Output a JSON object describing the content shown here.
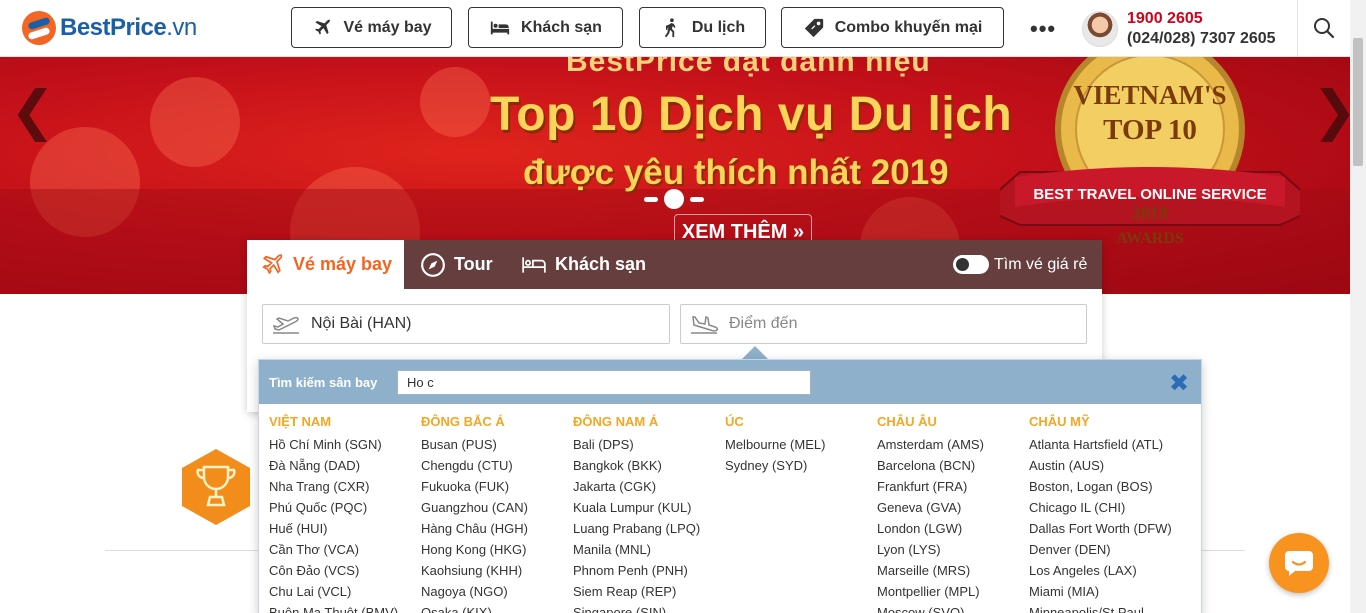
{
  "header": {
    "logo_brand": "BestPrice",
    "logo_tld": ".vn",
    "nav": [
      {
        "label": "Vé máy bay",
        "icon": "plane-icon"
      },
      {
        "label": "Khách sạn",
        "icon": "bed-icon"
      },
      {
        "label": "Du lịch",
        "icon": "hiker-icon"
      },
      {
        "label": "Combo khuyến mại",
        "icon": "tag-icon"
      }
    ],
    "more": "•••",
    "hotline_primary": "1900 2605",
    "hotline_secondary": "(024/028) 7307 2605",
    "search_icon": "search-icon"
  },
  "banner": {
    "top_text": "BestPrice đạt danh hiệu",
    "title": "Top 10 Dịch vụ Du lịch",
    "subtitle": "được yêu thích nhất 2019",
    "cta": "XEM THÊM »",
    "prev": "❮",
    "next": "❯",
    "award_line1": "VIETNAM'S",
    "award_line2": "TOP 10",
    "award_ribbon": "BEST TRAVEL ONLINE SERVICE",
    "award_year": "2019",
    "award_bottom": "AWARDS",
    "slides": 3,
    "active_slide": 2
  },
  "search": {
    "tabs": [
      {
        "label": "Vé máy bay",
        "active": true
      },
      {
        "label": "Tour",
        "active": false
      },
      {
        "label": "Khách sạn",
        "active": false
      }
    ],
    "cheap_toggle_label": "Tìm vé giá rẻ",
    "cheap_toggle_on": false,
    "from_value": "Nội Bài (HAN)",
    "to_placeholder": "Điểm đến"
  },
  "airport_popup": {
    "label": "Tìm kiếm sân bay",
    "query": "Ho c",
    "close": "✖",
    "columns": [
      {
        "title": "VIỆT NAM",
        "items": [
          "Hồ Chí Minh (SGN)",
          "Đà Nẵng (DAD)",
          "Nha Trang (CXR)",
          "Phú Quốc (PQC)",
          "Huế (HUI)",
          "Cần Thơ (VCA)",
          "Côn Đảo (VCS)",
          "Chu Lai (VCL)",
          "Buôn Ma Thuột (BMV)"
        ]
      },
      {
        "title": "ĐÔNG BẮC Á",
        "items": [
          "Busan (PUS)",
          "Chengdu (CTU)",
          "Fukuoka (FUK)",
          "Guangzhou (CAN)",
          "Hàng Châu (HGH)",
          "Hong Kong (HKG)",
          "Kaohsiung (KHH)",
          "Nagoya (NGO)",
          "Osaka (KIX)"
        ]
      },
      {
        "title": "ĐÔNG NAM Á",
        "items": [
          "Bali (DPS)",
          "Bangkok (BKK)",
          "Jakarta (CGK)",
          "Kuala Lumpur (KUL)",
          "Luang Prabang (LPQ)",
          "Manila (MNL)",
          "Phnom Penh (PNH)",
          "Siem Reap (REP)",
          "Singapore (SIN)"
        ]
      },
      {
        "title": "ÚC",
        "items": [
          "Melbourne (MEL)",
          "Sydney (SYD)"
        ]
      },
      {
        "title": "CHÂU ÂU",
        "items": [
          "Amsterdam (AMS)",
          "Barcelona (BCN)",
          "Frankfurt (FRA)",
          "Geneva (GVA)",
          "London (LGW)",
          "Lyon (LYS)",
          "Marseille (MRS)",
          "Montpellier (MPL)",
          "Moscow (SVO)"
        ]
      },
      {
        "title": "CHÂU MỸ",
        "items": [
          "Atlanta Hartsfield (ATL)",
          "Austin (AUS)",
          "Boston, Logan (BOS)",
          "Chicago IL (CHI)",
          "Dallas Fort Worth (DFW)",
          "Denver (DEN)",
          "Los Angeles (LAX)",
          "Miami (MIA)",
          "Minneapolis/St.Paul"
        ]
      }
    ]
  },
  "colors": {
    "brand_orange": "#f26522",
    "brand_blue": "#1a5fa8",
    "hotline_red": "#d0021b",
    "region_heading": "#f5a623",
    "popup_header": "#8fb0cb"
  }
}
